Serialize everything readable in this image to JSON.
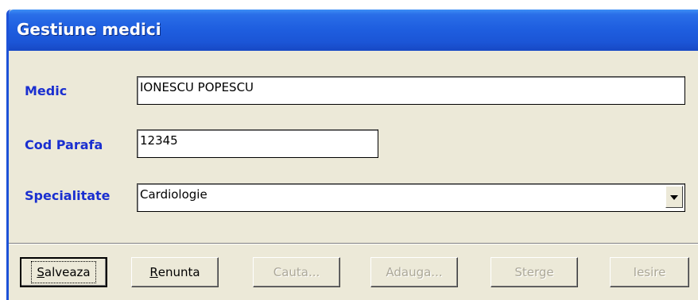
{
  "window": {
    "title": "Gestiune medici"
  },
  "form": {
    "medic": {
      "label": "Medic",
      "value": "IONESCU POPESCU"
    },
    "cod_parafa": {
      "label": "Cod Parafa",
      "value": "12345"
    },
    "specialitate": {
      "label": "Specialitate",
      "value": "Cardiologie"
    }
  },
  "buttons": {
    "salveaza": {
      "accel": "S",
      "rest": "alveaza",
      "enabled": true,
      "default": true
    },
    "renunta": {
      "accel": "R",
      "rest": "enunta",
      "enabled": true
    },
    "cauta": {
      "label": "Cauta...",
      "enabled": false
    },
    "adauga": {
      "label": "Adauga...",
      "enabled": false
    },
    "sterge": {
      "label": "Sterge",
      "enabled": false
    },
    "iesire": {
      "label": "Iesire",
      "enabled": false
    }
  },
  "icons": {
    "combo": "chevron-down-icon"
  },
  "colors": {
    "title_bar": "#1f5fe0",
    "label_text": "#1a2fd0",
    "disabled_text": "#aca899"
  }
}
